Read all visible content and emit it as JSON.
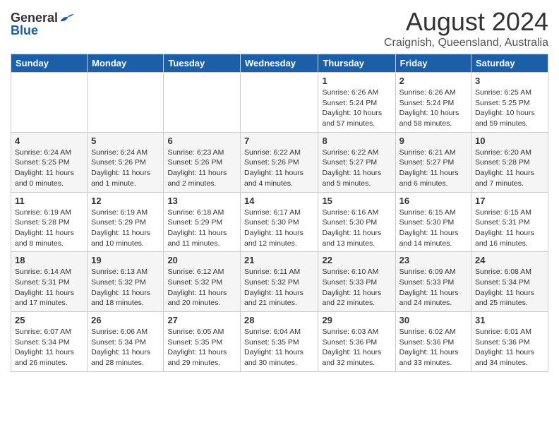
{
  "header": {
    "logo_general": "General",
    "logo_blue": "Blue",
    "month": "August 2024",
    "location": "Craignish, Queensland, Australia"
  },
  "days_of_week": [
    "Sunday",
    "Monday",
    "Tuesday",
    "Wednesday",
    "Thursday",
    "Friday",
    "Saturday"
  ],
  "weeks": [
    [
      {
        "day": "",
        "info": ""
      },
      {
        "day": "",
        "info": ""
      },
      {
        "day": "",
        "info": ""
      },
      {
        "day": "",
        "info": ""
      },
      {
        "day": "1",
        "info": "Sunrise: 6:26 AM\nSunset: 5:24 PM\nDaylight: 10 hours\nand 57 minutes."
      },
      {
        "day": "2",
        "info": "Sunrise: 6:26 AM\nSunset: 5:24 PM\nDaylight: 10 hours\nand 58 minutes."
      },
      {
        "day": "3",
        "info": "Sunrise: 6:25 AM\nSunset: 5:25 PM\nDaylight: 10 hours\nand 59 minutes."
      }
    ],
    [
      {
        "day": "4",
        "info": "Sunrise: 6:24 AM\nSunset: 5:25 PM\nDaylight: 11 hours\nand 0 minutes."
      },
      {
        "day": "5",
        "info": "Sunrise: 6:24 AM\nSunset: 5:26 PM\nDaylight: 11 hours\nand 1 minute."
      },
      {
        "day": "6",
        "info": "Sunrise: 6:23 AM\nSunset: 5:26 PM\nDaylight: 11 hours\nand 2 minutes."
      },
      {
        "day": "7",
        "info": "Sunrise: 6:22 AM\nSunset: 5:26 PM\nDaylight: 11 hours\nand 4 minutes."
      },
      {
        "day": "8",
        "info": "Sunrise: 6:22 AM\nSunset: 5:27 PM\nDaylight: 11 hours\nand 5 minutes."
      },
      {
        "day": "9",
        "info": "Sunrise: 6:21 AM\nSunset: 5:27 PM\nDaylight: 11 hours\nand 6 minutes."
      },
      {
        "day": "10",
        "info": "Sunrise: 6:20 AM\nSunset: 5:28 PM\nDaylight: 11 hours\nand 7 minutes."
      }
    ],
    [
      {
        "day": "11",
        "info": "Sunrise: 6:19 AM\nSunset: 5:28 PM\nDaylight: 11 hours\nand 8 minutes."
      },
      {
        "day": "12",
        "info": "Sunrise: 6:19 AM\nSunset: 5:29 PM\nDaylight: 11 hours\nand 10 minutes."
      },
      {
        "day": "13",
        "info": "Sunrise: 6:18 AM\nSunset: 5:29 PM\nDaylight: 11 hours\nand 11 minutes."
      },
      {
        "day": "14",
        "info": "Sunrise: 6:17 AM\nSunset: 5:30 PM\nDaylight: 11 hours\nand 12 minutes."
      },
      {
        "day": "15",
        "info": "Sunrise: 6:16 AM\nSunset: 5:30 PM\nDaylight: 11 hours\nand 13 minutes."
      },
      {
        "day": "16",
        "info": "Sunrise: 6:15 AM\nSunset: 5:30 PM\nDaylight: 11 hours\nand 14 minutes."
      },
      {
        "day": "17",
        "info": "Sunrise: 6:15 AM\nSunset: 5:31 PM\nDaylight: 11 hours\nand 16 minutes."
      }
    ],
    [
      {
        "day": "18",
        "info": "Sunrise: 6:14 AM\nSunset: 5:31 PM\nDaylight: 11 hours\nand 17 minutes."
      },
      {
        "day": "19",
        "info": "Sunrise: 6:13 AM\nSunset: 5:32 PM\nDaylight: 11 hours\nand 18 minutes."
      },
      {
        "day": "20",
        "info": "Sunrise: 6:12 AM\nSunset: 5:32 PM\nDaylight: 11 hours\nand 20 minutes."
      },
      {
        "day": "21",
        "info": "Sunrise: 6:11 AM\nSunset: 5:32 PM\nDaylight: 11 hours\nand 21 minutes."
      },
      {
        "day": "22",
        "info": "Sunrise: 6:10 AM\nSunset: 5:33 PM\nDaylight: 11 hours\nand 22 minutes."
      },
      {
        "day": "23",
        "info": "Sunrise: 6:09 AM\nSunset: 5:33 PM\nDaylight: 11 hours\nand 24 minutes."
      },
      {
        "day": "24",
        "info": "Sunrise: 6:08 AM\nSunset: 5:34 PM\nDaylight: 11 hours\nand 25 minutes."
      }
    ],
    [
      {
        "day": "25",
        "info": "Sunrise: 6:07 AM\nSunset: 5:34 PM\nDaylight: 11 hours\nand 26 minutes."
      },
      {
        "day": "26",
        "info": "Sunrise: 6:06 AM\nSunset: 5:34 PM\nDaylight: 11 hours\nand 28 minutes."
      },
      {
        "day": "27",
        "info": "Sunrise: 6:05 AM\nSunset: 5:35 PM\nDaylight: 11 hours\nand 29 minutes."
      },
      {
        "day": "28",
        "info": "Sunrise: 6:04 AM\nSunset: 5:35 PM\nDaylight: 11 hours\nand 30 minutes."
      },
      {
        "day": "29",
        "info": "Sunrise: 6:03 AM\nSunset: 5:36 PM\nDaylight: 11 hours\nand 32 minutes."
      },
      {
        "day": "30",
        "info": "Sunrise: 6:02 AM\nSunset: 5:36 PM\nDaylight: 11 hours\nand 33 minutes."
      },
      {
        "day": "31",
        "info": "Sunrise: 6:01 AM\nSunset: 5:36 PM\nDaylight: 11 hours\nand 34 minutes."
      }
    ]
  ]
}
